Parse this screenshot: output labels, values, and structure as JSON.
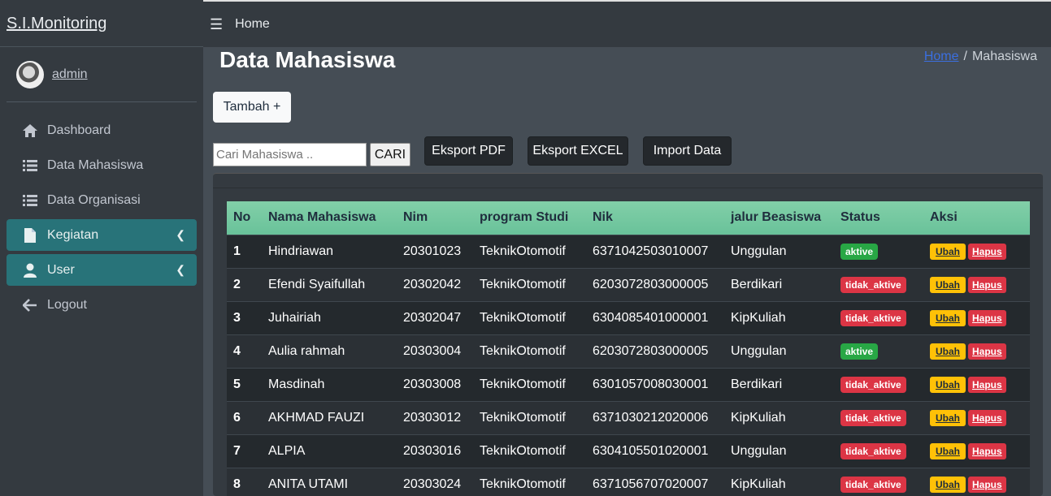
{
  "brand": "S.I.Monitoring",
  "user": {
    "name": "admin"
  },
  "sidebar": {
    "items": [
      {
        "label": "Dashboard",
        "icon": "home-icon"
      },
      {
        "label": "Data Mahasiswa",
        "icon": "list-icon"
      },
      {
        "label": "Data Organisasi",
        "icon": "list-icon"
      },
      {
        "label": "Kegiatan",
        "icon": "file-icon"
      },
      {
        "label": "User",
        "icon": "user-icon"
      },
      {
        "label": "Logout",
        "icon": "arrow-left-icon"
      }
    ]
  },
  "topbar": {
    "home": "Home"
  },
  "page": {
    "title": "Data Mahasiswa"
  },
  "breadcrumb": {
    "home": "Home",
    "sep": "/",
    "current": "Mahasiswa"
  },
  "toolbar": {
    "add": "Tambah +",
    "search_placeholder": "Cari Mahasiswa ..",
    "search_button": "CARI",
    "export_pdf": "Eksport PDF",
    "export_excel": "Eksport EXCEL",
    "import": "Import Data"
  },
  "table": {
    "headers": [
      "No",
      "Nama Mahasiswa",
      "Nim",
      "program Studi",
      "Nik",
      "jalur Beasiswa",
      "Status",
      "Aksi"
    ],
    "action_edit": "Ubah",
    "action_delete": "Hapus",
    "rows": [
      {
        "no": "1",
        "nama": "Hindriawan",
        "nim": "20301023",
        "prodi": "TeknikOtomotif",
        "nik": "6371042503010007",
        "jalur": "Unggulan",
        "status": "aktive"
      },
      {
        "no": "2",
        "nama": "Efendi Syaifullah",
        "nim": "20302042",
        "prodi": "TeknikOtomotif",
        "nik": "6203072803000005",
        "jalur": "Berdikari",
        "status": "tidak_aktive"
      },
      {
        "no": "3",
        "nama": "Juhairiah",
        "nim": "20302047",
        "prodi": "TeknikOtomotif",
        "nik": "6304085401000001",
        "jalur": "KipKuliah",
        "status": "tidak_aktive"
      },
      {
        "no": "4",
        "nama": "Aulia rahmah",
        "nim": "20303004",
        "prodi": "TeknikOtomotif",
        "nik": "6203072803000005",
        "jalur": "Unggulan",
        "status": "aktive"
      },
      {
        "no": "5",
        "nama": "Masdinah",
        "nim": "20303008",
        "prodi": "TeknikOtomotif",
        "nik": "6301057008030001",
        "jalur": "Berdikari",
        "status": "tidak_aktive"
      },
      {
        "no": "6",
        "nama": "AKHMAD FAUZI",
        "nim": "20303012",
        "prodi": "TeknikOtomotif",
        "nik": "6371030212020006",
        "jalur": "KipKuliah",
        "status": "tidak_aktive"
      },
      {
        "no": "7",
        "nama": "ALPIA",
        "nim": "20303016",
        "prodi": "TeknikOtomotif",
        "nik": "6304105501020001",
        "jalur": "Unggulan",
        "status": "tidak_aktive"
      },
      {
        "no": "8",
        "nama": "ANITA UTAMI",
        "nim": "20303024",
        "prodi": "TeknikOtomotif",
        "nik": "6371056707020007",
        "jalur": "KipKuliah",
        "status": "tidak_aktive"
      }
    ]
  },
  "colors": {
    "status_active": "#28a745",
    "status_inactive": "#dc3545",
    "edit": "#ffc107",
    "delete": "#dc3545",
    "header": "#75c9a1"
  }
}
